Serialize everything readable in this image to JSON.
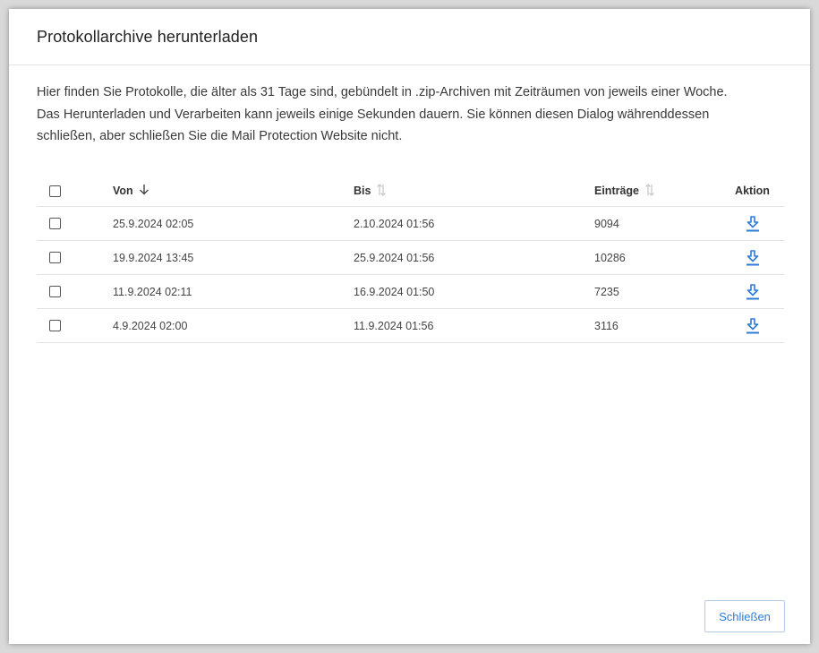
{
  "dialog": {
    "title": "Protokollarchive herunterladen",
    "description": [
      "Hier finden Sie Protokolle, die älter als 31 Tage sind, gebündelt in .zip-Archiven mit Zeiträumen von jeweils einer Woche.",
      "Das Herunterladen und Verarbeiten kann jeweils einige Sekunden dauern. Sie können diesen Dialog währenddessen",
      "schließen, aber schließen Sie die Mail Protection Website nicht."
    ],
    "close_label": "Schließen"
  },
  "table": {
    "columns": {
      "von": "Von",
      "bis": "Bis",
      "eintraege": "Einträge",
      "aktion": "Aktion"
    },
    "rows": [
      {
        "von": "25.9.2024 02:05",
        "bis": "2.10.2024 01:56",
        "eintraege": "9094"
      },
      {
        "von": "19.9.2024 13:45",
        "bis": "25.9.2024 01:56",
        "eintraege": "10286"
      },
      {
        "von": "11.9.2024 02:11",
        "bis": "16.9.2024 01:50",
        "eintraege": "7235"
      },
      {
        "von": "4.9.2024 02:00",
        "bis": "11.9.2024 01:56",
        "eintraege": "3116"
      }
    ]
  },
  "icons": {
    "sort_active": "arrow-down-icon",
    "sort_inactive": "sort-updown-icon",
    "download": "download-icon"
  },
  "colors": {
    "accent": "#2e7bd6",
    "border": "#e3e3e3"
  }
}
